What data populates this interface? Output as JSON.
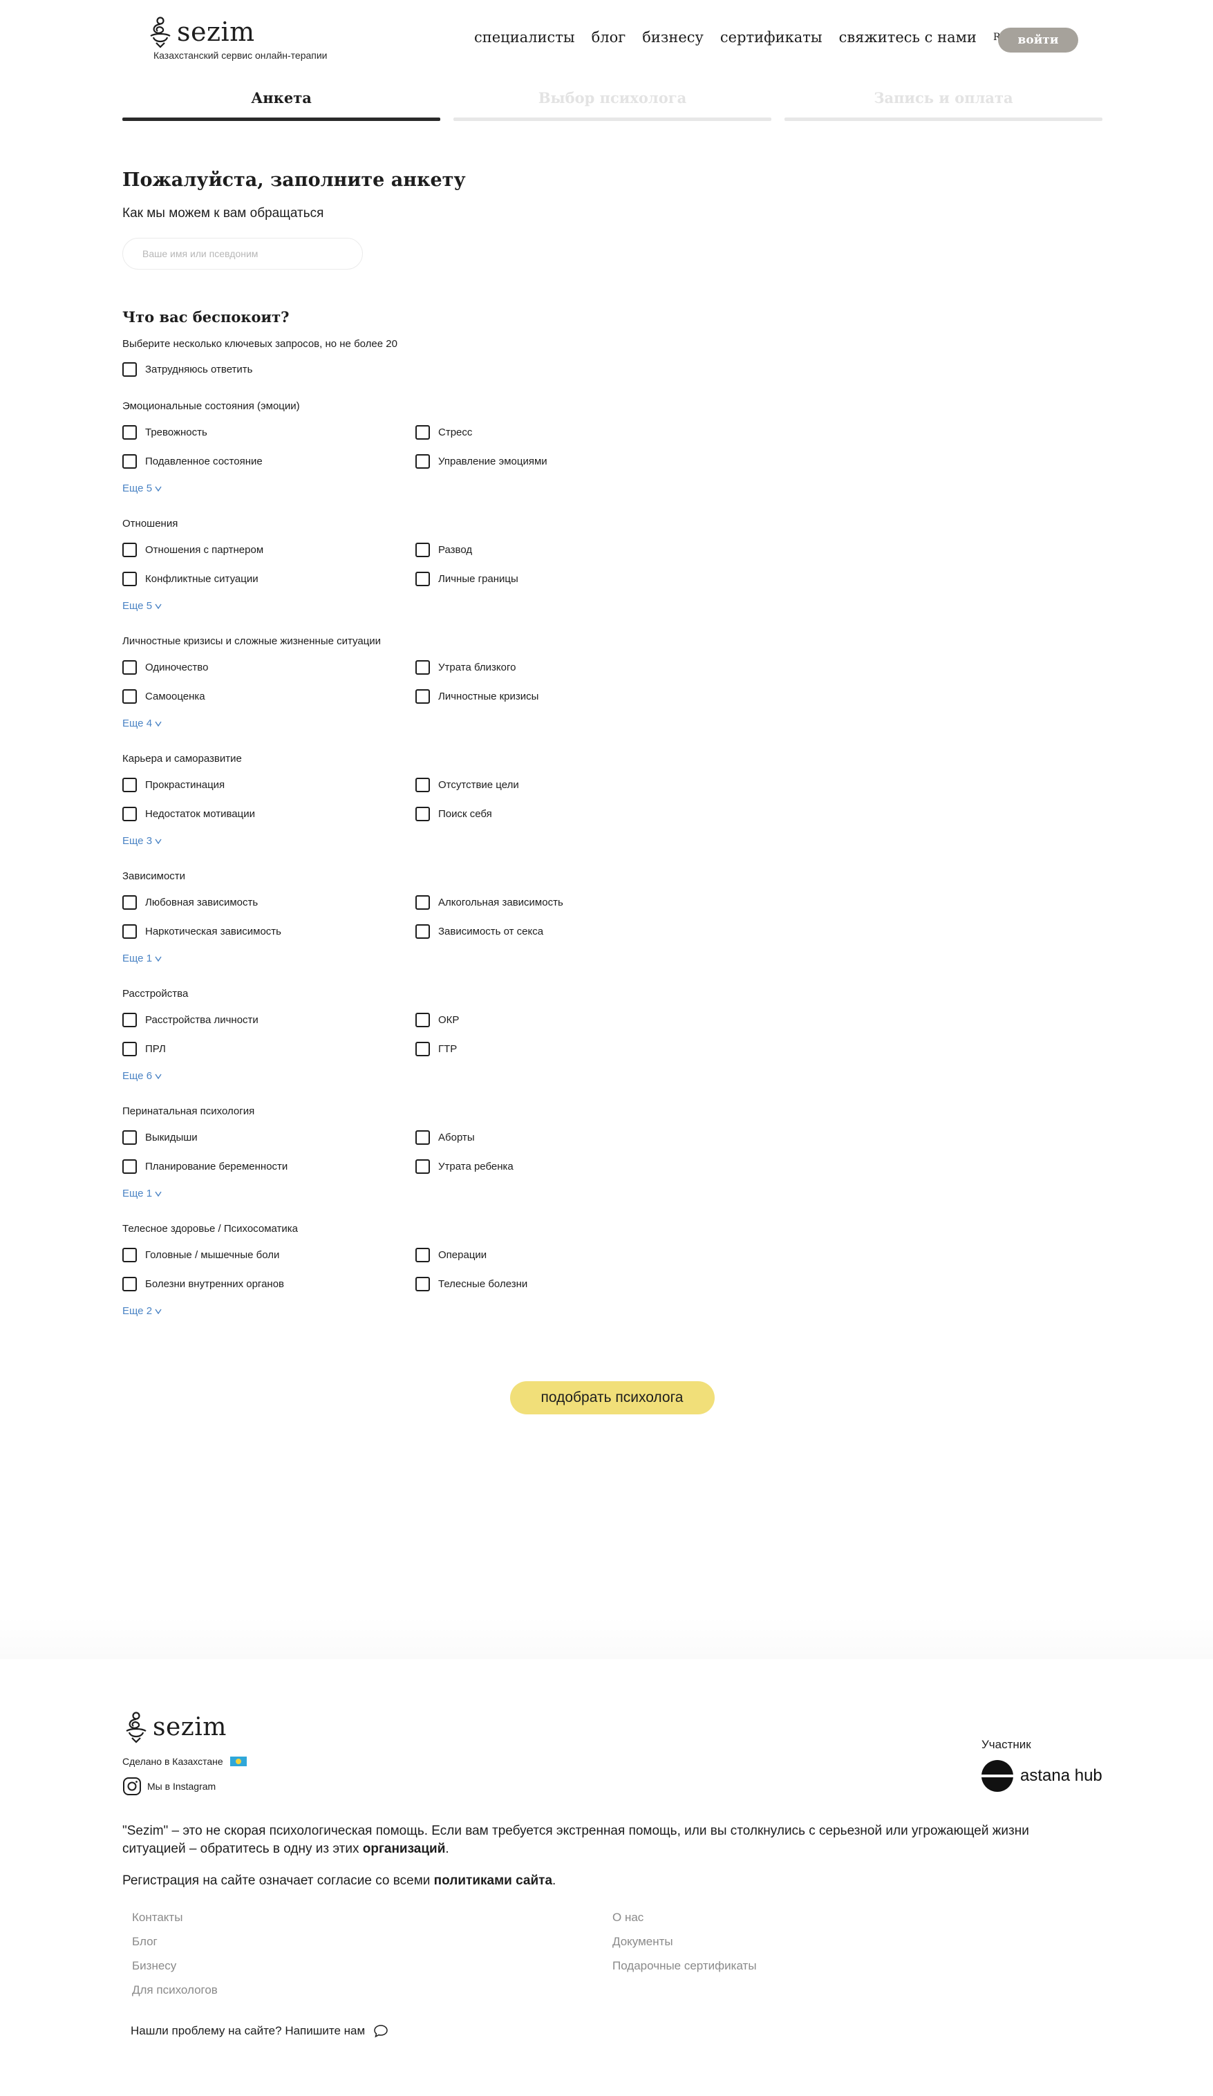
{
  "header": {
    "logo_text": "sezim",
    "tagline": "Казахстанский сервис онлайн-терапии",
    "nav": [
      "специалисты",
      "блог",
      "бизнесу",
      "сертификаты",
      "свяжитесь с нами"
    ],
    "lang": "RU",
    "login": "войти"
  },
  "steps": [
    {
      "label": "Анкета",
      "state": "active"
    },
    {
      "label": "Выбор психолога",
      "state": "inactive"
    },
    {
      "label": "Запись и оплата",
      "state": "inactive"
    }
  ],
  "form": {
    "title": "Пожалуйста, заполните анкету",
    "name_label": "Как мы можем к вам обращаться",
    "name_placeholder": "Ваше имя или псевдоним",
    "question_title": "Что вас беспокоит?",
    "question_hint": "Выберите несколько ключевых запросов, но не более 20",
    "hard_to_answer": "Затрудняюсь ответить",
    "categories": [
      {
        "title": "Эмоциональные состояния (эмоции)",
        "options": [
          "Тревожность",
          "Стресс",
          "Подавленное состояние",
          "Управление эмоциями"
        ],
        "more": "Еще 5"
      },
      {
        "title": "Отношения",
        "options": [
          "Отношения с партнером",
          "Развод",
          "Конфликтные ситуации",
          "Личные границы"
        ],
        "more": "Еще 5"
      },
      {
        "title": "Личностные кризисы и сложные жизненные ситуации",
        "options": [
          "Одиночество",
          "Утрата близкого",
          "Самооценка",
          "Личностные кризисы"
        ],
        "more": "Еще 4"
      },
      {
        "title": "Карьера и саморазвитие",
        "options": [
          "Прокрастинация",
          "Отсутствие цели",
          "Недостаток мотивации",
          "Поиск себя"
        ],
        "more": "Еще 3"
      },
      {
        "title": "Зависимости",
        "options": [
          "Любовная зависимость",
          "Алкогольная зависимость",
          "Наркотическая зависимость",
          "Зависимость от секса"
        ],
        "more": "Еще 1"
      },
      {
        "title": "Расстройства",
        "options": [
          "Расстройства личности",
          "ОКР",
          "ПРЛ",
          "ГТР"
        ],
        "more": "Еще 6"
      },
      {
        "title": "Перинатальная психология",
        "options": [
          "Выкидыши",
          "Аборты",
          "Планирование беременности",
          "Утрата ребенка"
        ],
        "more": "Еще 1"
      },
      {
        "title": "Телесное здоровье / Психосоматика",
        "options": [
          "Головные / мышечные боли",
          "Операции",
          "Болезни внутренних органов",
          "Телесные болезни"
        ],
        "more": "Еще 2"
      }
    ],
    "submit": "подобрать психолога"
  },
  "footer": {
    "logo_text": "sezim",
    "made_in": "Сделано в Казахстане",
    "instagram": "Мы в Instagram",
    "partner_label": "Участник",
    "partner_name": "astana hub",
    "disclaimer_start": "\"Sezim\" – это не скорая психологическая помощь. Если вам требуется экстренная помощь, или вы столкнулись с серьезной или угрожающей жизни ситуацией – обратитесь в одну из этих ",
    "disclaimer_link": "организаций",
    "disclaimer_end": ".",
    "reg_start": "Регистрация на сайте означает согласие со всеми ",
    "reg_link": "политиками сайта",
    "reg_end": ".",
    "links_col1": [
      "Контакты",
      "Блог",
      "Бизнесу",
      "Для психологов"
    ],
    "links_col2": [
      "О нас",
      "Документы",
      "Подарочные сертификаты"
    ],
    "problem": "Нашли проблему на сайте? Напишите нам"
  }
}
